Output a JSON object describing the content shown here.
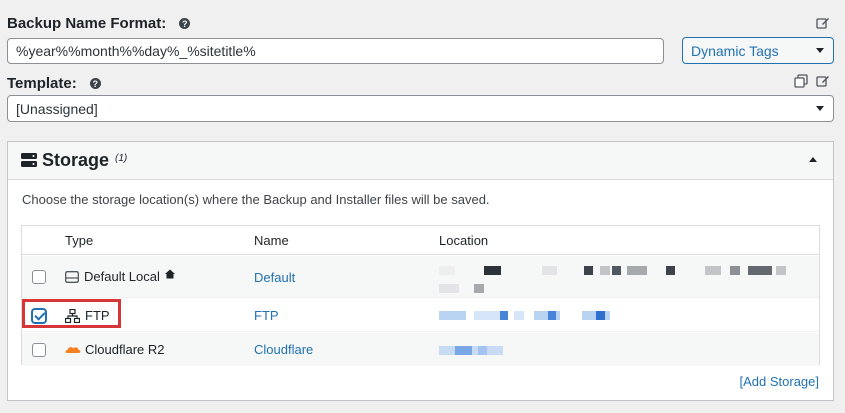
{
  "backup_name": {
    "label": "Backup Name Format:",
    "value": "%year%%month%%day%_%sitetitle%",
    "dynamic_tags_label": "Dynamic Tags"
  },
  "template": {
    "label": "Template:",
    "value": "[Unassigned]"
  },
  "storage": {
    "title": "Storage",
    "count": "(1)",
    "description": "Choose the storage location(s) where the Backup and Installer files will be saved.",
    "columns": [
      "Type",
      "Name",
      "Location"
    ],
    "rows": [
      {
        "type": "Default Local",
        "name": "Default",
        "checked": false,
        "icon": "hard-drive-icon"
      },
      {
        "type": "FTP",
        "name": "FTP",
        "checked": true,
        "icon": "network-icon"
      },
      {
        "type": "Cloudflare R2",
        "name": "Cloudflare",
        "checked": false,
        "icon": "cloud-icon"
      }
    ],
    "add_label": "[Add Storage]"
  },
  "colors": {
    "accent": "#2271b1",
    "highlight_border": "#d63638",
    "cloudflare_orange": "#f48120"
  }
}
